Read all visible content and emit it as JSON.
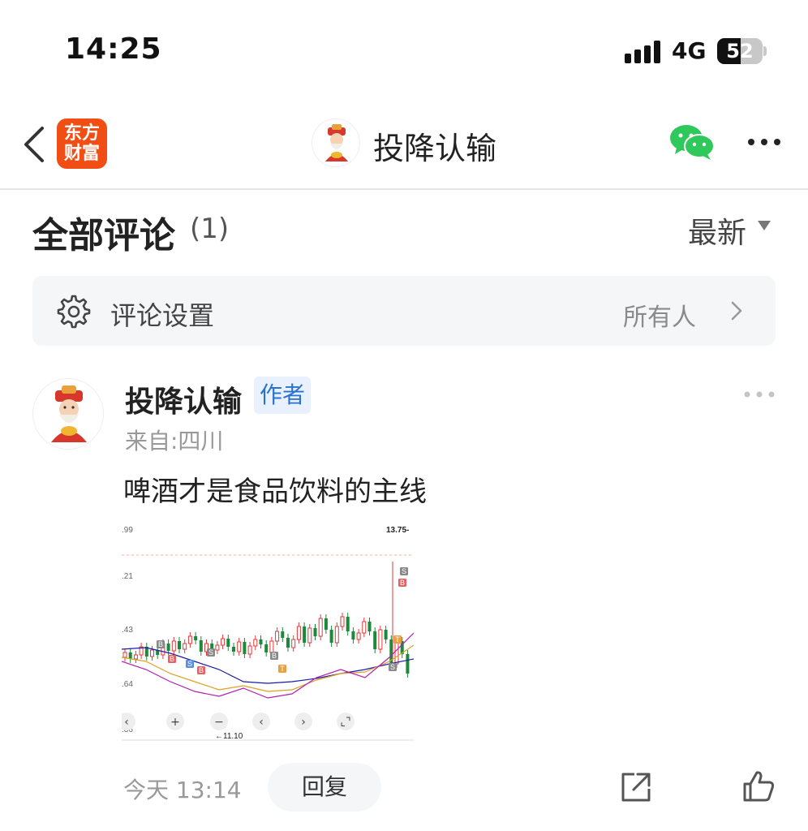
{
  "status_bar": {
    "time": "14:25",
    "network": "4G",
    "battery": "52",
    "battery_level_percent": 52
  },
  "nav": {
    "logo_line1": "东方",
    "logo_line2": "财富",
    "title": "投降认输",
    "logo_color": "#f04e14",
    "icons": [
      "back-chevron-icon",
      "wechat-icon",
      "more-icon"
    ]
  },
  "comments": {
    "title": "全部评论",
    "count": "(1)",
    "sort": "最新"
  },
  "settings": {
    "label": "评论设置",
    "value": "所有人"
  },
  "comment": {
    "author": "投降认输",
    "badge": "作者",
    "from": "来自:四川",
    "text": "啤酒才是食品饮料的主线",
    "time": "今天 13:14",
    "reply_label": "回复",
    "image": {
      "price_top_right": "13.75-",
      "price_labels": [
        ".99",
        ".21",
        ".43",
        ".64",
        ".86"
      ],
      "low_marker": "←11.10",
      "control_symbols": [
        "+",
        "−",
        "‹",
        "›",
        "⌞⌝"
      ]
    }
  },
  "colors": {
    "accent_blue": "#2a72d0",
    "up_red": "#e03a3a",
    "down_green": "#1a8a3a",
    "muted_text": "#999999"
  }
}
